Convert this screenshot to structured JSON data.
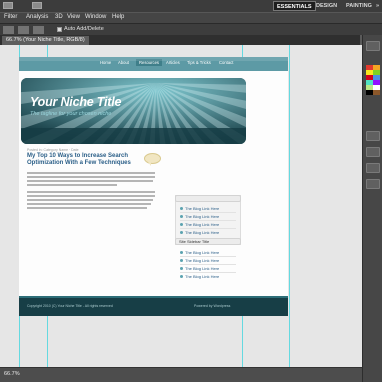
{
  "workspace": {
    "buttons": [
      "ESSENTIALS",
      "DESIGN",
      "PAINTING"
    ],
    "active": "ESSENTIALS",
    "overflow": "»"
  },
  "menu": [
    "Filter",
    "Analysis",
    "3D",
    "View",
    "Window",
    "Help"
  ],
  "options_bar": {
    "auto_add_delete_label": "Auto Add/Delete",
    "auto_add_delete_checked": true
  },
  "document_tab": {
    "label": "66.7% (Your Niche Title, RGB/8)"
  },
  "webpage": {
    "nav": [
      "Home",
      "About",
      "Resources",
      "Articles",
      "Tips & Tricks",
      "Contact"
    ],
    "nav_current": "Resources",
    "site_title": "Your Niche Title",
    "site_tagline": "The tagline for your chosen niche",
    "post": {
      "meta": "Posted in: Category Name · Date",
      "title": "My Top 10 Ways to Increase Search Optimization With a Few Techniques"
    },
    "sidebar": {
      "links_top": [
        "The Blog Link Here",
        "The Blog Link Here",
        "The Blog Link Here",
        "The Blog Link Here"
      ],
      "widget_title": "Site Sidebar Title",
      "links_bottom": [
        "The Blog Link Here",
        "The Blog Link Here",
        "The Blog Link Here",
        "The Blog Link Here"
      ]
    },
    "footer": {
      "left": "Copyright 2010 (C) Your Niche Title - All rights reserved",
      "right": "Powered by Wordpress"
    }
  },
  "status_bar": {
    "zoom": "66.7%",
    "info": ""
  },
  "colors": {
    "accent_teal": "#5d9aa5",
    "header_dark": "#1f4a52",
    "link_blue": "#2b5f88",
    "guides": "#43d6df",
    "swatches": [
      "#e23a2e",
      "#f5a623",
      "#f8e71c",
      "#7ed321",
      "#d0021b",
      "#4a90e2",
      "#50e3c2",
      "#9013fe",
      "#b8e986",
      "#ffffff",
      "#000000",
      "#8b572a"
    ]
  }
}
